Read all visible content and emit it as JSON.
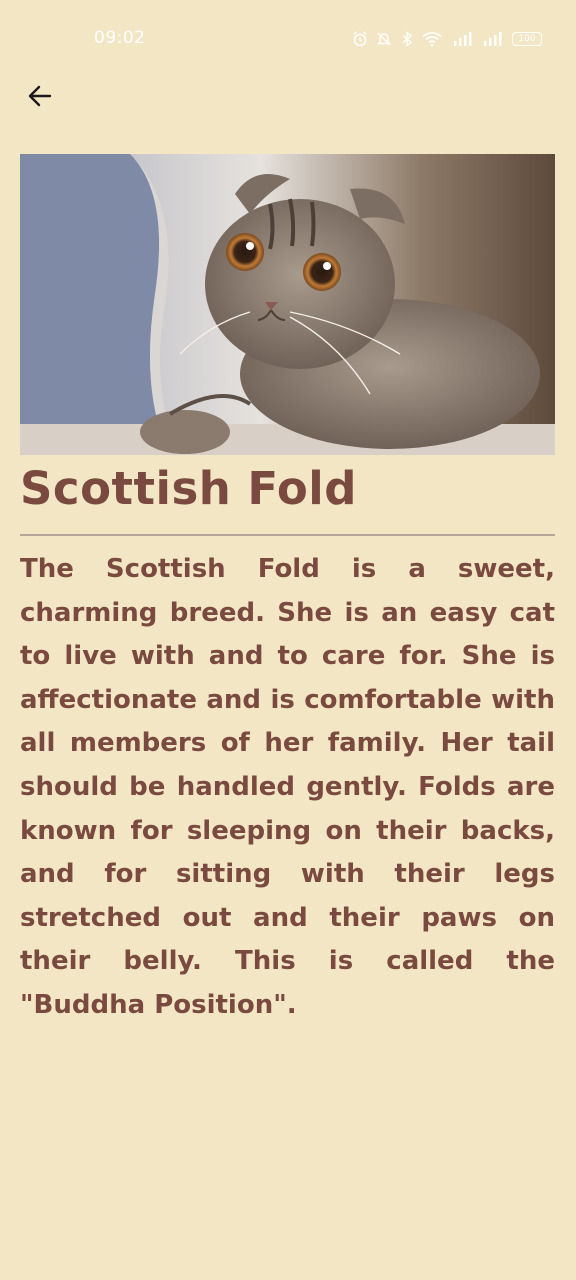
{
  "status_bar": {
    "time": "09:02",
    "battery": "100"
  },
  "nav": {
    "back_icon": "arrow-left-icon"
  },
  "hero_image": {
    "alt": "cat-photo"
  },
  "breed": {
    "title": "Scottish Fold",
    "description": "The Scottish Fold is a sweet, charming breed. She is an easy cat to live with and to care for. She is affectionate and is comfortable with all members of her family. Her tail should be handled gently. Folds are known for sleeping on their backs, and for sitting with their legs stretched out and their paws on their belly. This is called the \"Buddha Position\"."
  },
  "colors": {
    "background": "#f2e6c4",
    "text": "#7a4a40",
    "divider": "#b7a79a"
  }
}
